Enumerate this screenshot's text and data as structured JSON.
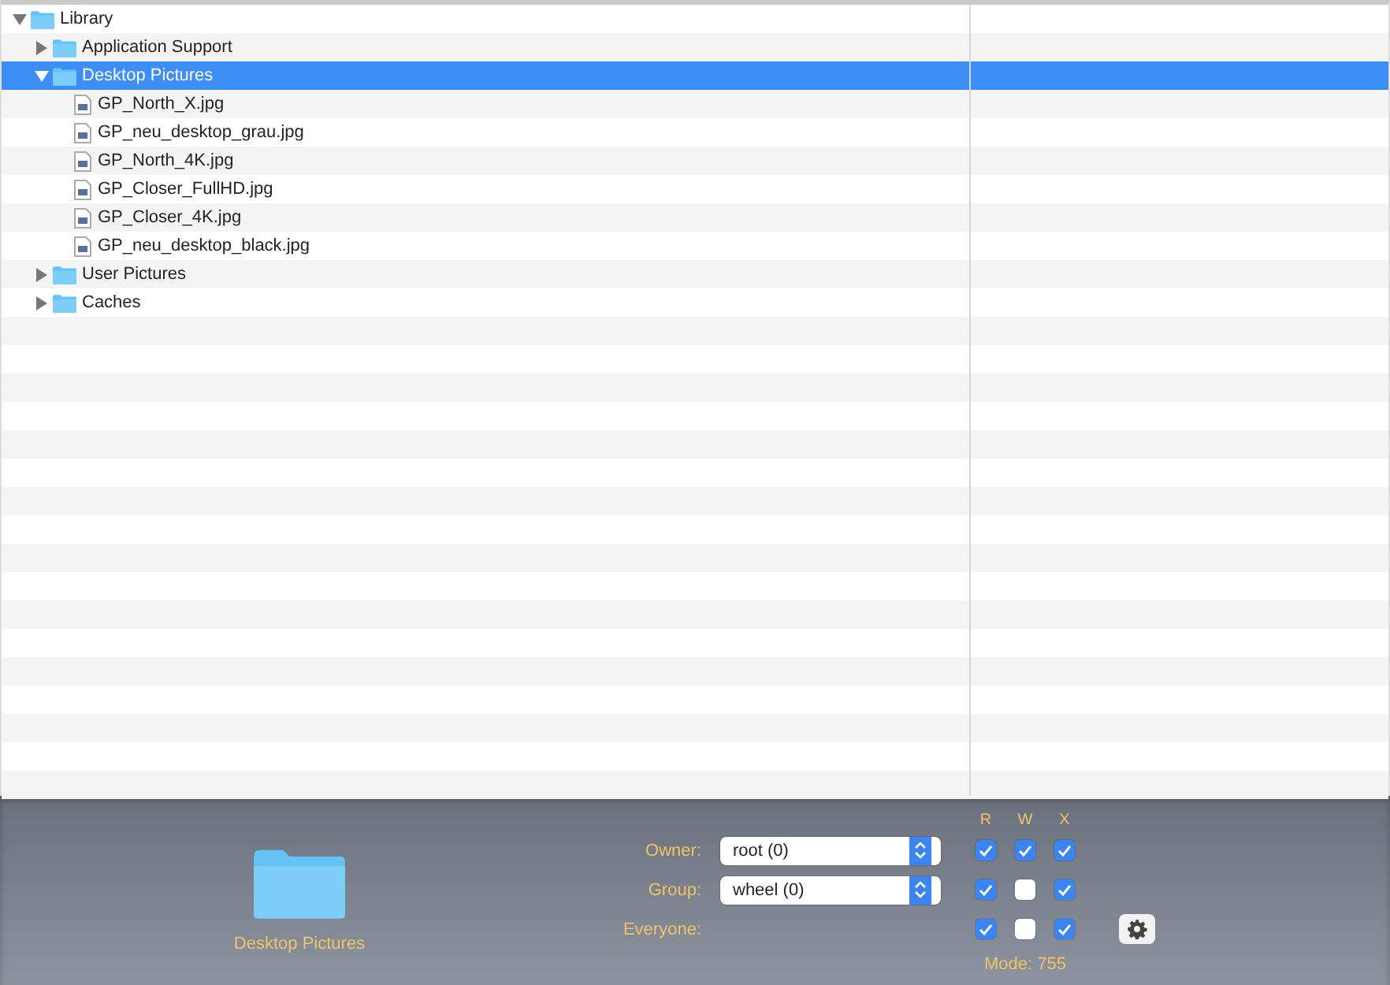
{
  "tree": [
    {
      "kind": "folder",
      "name": "Library",
      "expanded": true,
      "selected": false,
      "children": [
        {
          "kind": "folder",
          "name": "Application Support",
          "expanded": false,
          "selected": false
        },
        {
          "kind": "folder",
          "name": "Desktop Pictures",
          "expanded": true,
          "selected": true,
          "children": [
            {
              "kind": "file",
              "name": "GP_North_X.jpg",
              "selected": false
            },
            {
              "kind": "file",
              "name": "GP_neu_desktop_grau.jpg",
              "selected": false
            },
            {
              "kind": "file",
              "name": "GP_North_4K.jpg",
              "selected": false
            },
            {
              "kind": "file",
              "name": "GP_Closer_FullHD.jpg",
              "selected": false
            },
            {
              "kind": "file",
              "name": "GP_Closer_4K.jpg",
              "selected": false
            },
            {
              "kind": "file",
              "name": "GP_neu_desktop_black.jpg",
              "selected": false
            }
          ]
        },
        {
          "kind": "folder",
          "name": "User Pictures",
          "expanded": false,
          "selected": false
        },
        {
          "kind": "folder",
          "name": "Caches",
          "expanded": false,
          "selected": false
        }
      ]
    }
  ],
  "info": {
    "name": "Desktop Pictures"
  },
  "permissions": {
    "headers": [
      "R",
      "W",
      "X"
    ],
    "rows": [
      {
        "label": "Owner:",
        "popup": "root (0)",
        "r": true,
        "w": true,
        "x": true
      },
      {
        "label": "Group:",
        "popup": "wheel (0)",
        "r": true,
        "w": false,
        "x": true
      },
      {
        "label": "Everyone:",
        "r": true,
        "w": false,
        "x": true
      }
    ],
    "mode": "Mode: 755"
  }
}
